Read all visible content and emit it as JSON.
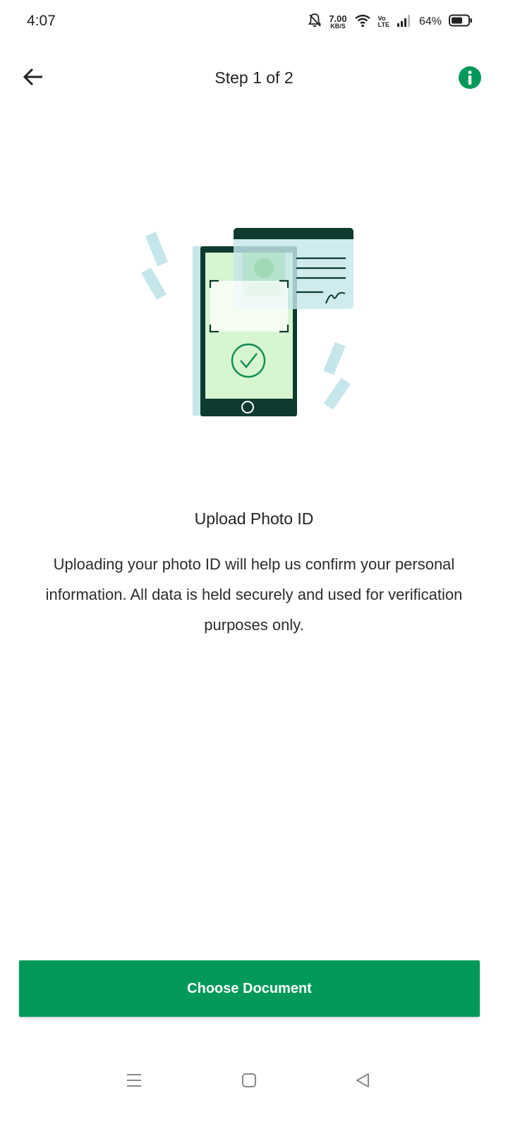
{
  "status_bar": {
    "time": "4:07",
    "net_speed_value": "7.00",
    "net_speed_unit": "KB/S",
    "volte_top": "Vo",
    "volte_bottom": "LTE",
    "battery_percent": "64%",
    "icons": [
      "bell-off-icon",
      "wifi-icon",
      "signal-icon",
      "battery-icon"
    ],
    "battery_level": 0.64
  },
  "app_bar": {
    "step_title": "Step 1 of 2",
    "back_icon": "arrow-left-icon",
    "info_icon": "info-icon"
  },
  "content": {
    "heading": "Upload Photo ID",
    "description": "Uploading your photo ID will help us confirm your personal information. All data is held securely and used for verification purposes only.",
    "illustration": "phone-scanning-id-card"
  },
  "cta": {
    "label": "Choose Document"
  },
  "nav_bar": {
    "icons": [
      "menu-icon",
      "home-icon",
      "back-triangle-icon"
    ]
  },
  "colors": {
    "accent": "#009959",
    "dark_green": "#0d3b2f",
    "light_green": "#d6f5d0",
    "light_blue": "#c5e6ea"
  }
}
